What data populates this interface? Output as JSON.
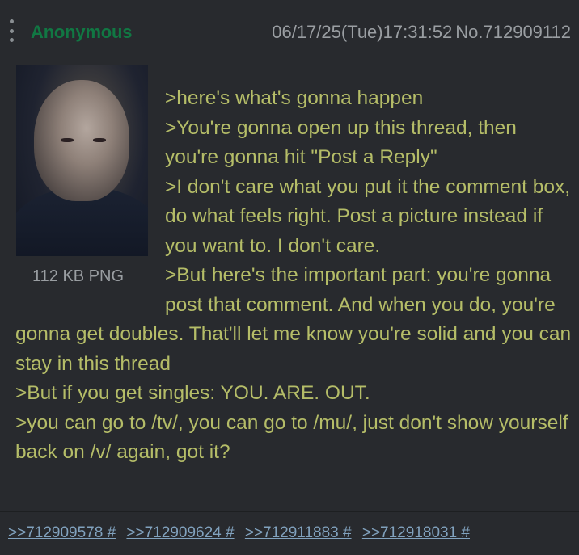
{
  "post": {
    "name": "Anonymous",
    "date": "06/17/25(Tue)17:31:52",
    "number": "No.712909112",
    "file_info": "112 KB PNG",
    "comment_lines": [
      ">here's what's gonna happen",
      ">You're gonna open up this thread, then you're gonna hit \"Post a Reply\"",
      ">I don't care what you put it the comment box, do what feels right. Post a picture instead if you want to. I don't care.",
      ">But here's the important part: you're gonna post that comment. And when you do, you're gonna get doubles. That'll let me know you're solid and you can stay in this thread",
      ">But if you get singles: YOU. ARE. OUT.",
      ">you can go to /tv/, you can go to /mu/, just don't show yourself back on /v/ again, got it?"
    ],
    "replies": [
      ">>712909578 #",
      ">>712909624 #",
      ">>712911883 #",
      ">>712918031 #"
    ]
  },
  "colors": {
    "background": "#282a2e",
    "name": "#117743",
    "greentext": "#b5bd68",
    "meta": "#9a9ea2",
    "link": "#81a2be"
  },
  "icons": {
    "menu": "vertical-dots-icon"
  }
}
